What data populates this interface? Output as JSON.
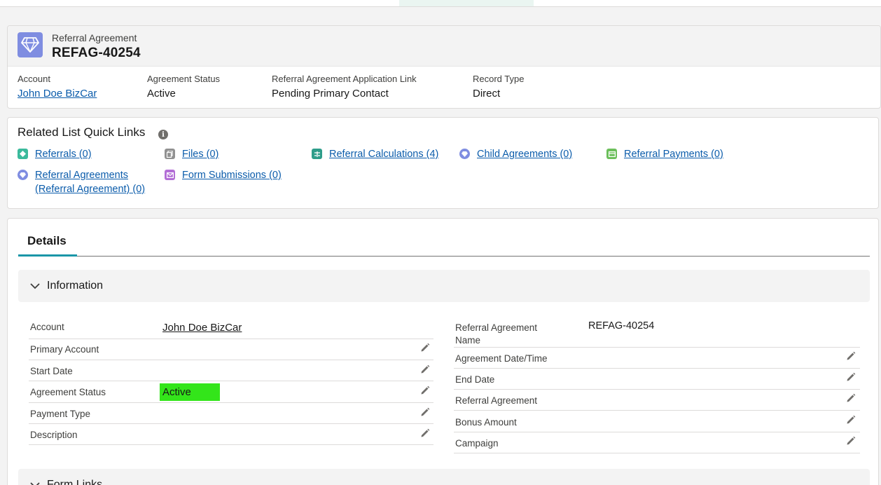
{
  "record": {
    "object_label": "Referral Agreement",
    "name": "REFAG-40254",
    "icon": "diamond-icon"
  },
  "highlights": [
    {
      "label": "Account",
      "value": "John Doe BizCar",
      "is_link": true
    },
    {
      "label": "Agreement Status",
      "value": "Active",
      "is_link": false
    },
    {
      "label": "Referral Agreement Application Link",
      "value": "Pending Primary Contact",
      "is_link": false
    },
    {
      "label": "Record Type",
      "value": "Direct",
      "is_link": false
    }
  ],
  "quick_links": {
    "title": "Related List Quick Links",
    "items": [
      {
        "label": "Referrals (0)",
        "icon": "referral-icon",
        "color": "#3bba9c"
      },
      {
        "label": "Files (0)",
        "icon": "file-icon",
        "color": "#919191"
      },
      {
        "label": "Referral Calculations (4)",
        "icon": "calculator-icon",
        "color": "#2e9d8a"
      },
      {
        "label": "Child Agreements (0)",
        "icon": "diamond-icon",
        "color": "#7f8de1"
      },
      {
        "label": "Referral Payments (0)",
        "icon": "payment-icon",
        "color": "#6cbf5b"
      },
      {
        "label": "Referral Agreements (Referral Agreement) (0)",
        "label_line1": "Referral Agreements",
        "label_line2": "(Referral Agreement) (0)",
        "icon": "diamond-icon",
        "color": "#7f8de1"
      },
      {
        "label": "Form Submissions (0)",
        "icon": "form-icon",
        "color": "#b36fd6"
      }
    ]
  },
  "details": {
    "tab_label": "Details",
    "sections": [
      {
        "title": "Information"
      },
      {
        "title": "Form Links"
      }
    ],
    "left_fields": [
      {
        "label": "Account",
        "value": "John Doe BizCar",
        "is_link": true
      },
      {
        "label": "Primary Account",
        "value": ""
      },
      {
        "label": "Start Date",
        "value": ""
      },
      {
        "label": "Agreement Status",
        "value": "Active",
        "highlighted": true
      },
      {
        "label": "Payment Type",
        "value": ""
      },
      {
        "label": "Description",
        "value": ""
      }
    ],
    "right_fields": [
      {
        "label": "Referral Agreement Name",
        "label_line1": "Referral Agreement",
        "label_line2": "Name",
        "value": "REFAG-40254"
      },
      {
        "label": "Agreement Date/Time",
        "value": ""
      },
      {
        "label": "End Date",
        "value": ""
      },
      {
        "label": "Referral Agreement",
        "value": ""
      },
      {
        "label": "Bonus Amount",
        "value": ""
      },
      {
        "label": "Campaign",
        "value": ""
      }
    ]
  },
  "colors": {
    "link": "#0b5cab",
    "record_icon": "#7f8de1",
    "tab_accent": "#1b96a8",
    "highlight": "#33e51a"
  }
}
